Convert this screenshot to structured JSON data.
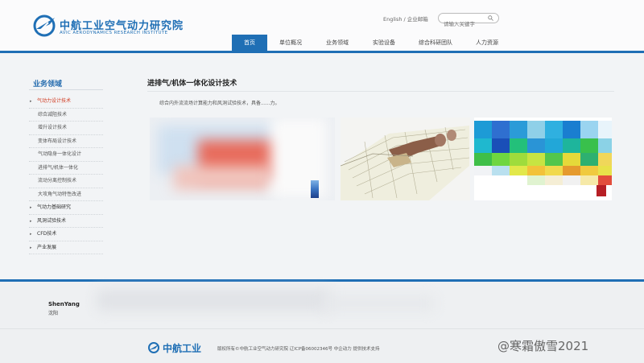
{
  "header": {
    "logo_cn": "中航工业空气动力研究院",
    "logo_en": "AVIC AERODYNAMICS RESEARCH INSTITUTE",
    "top_links": "English / 企业邮箱",
    "search_placeholder": "请输入关键字",
    "nav": [
      {
        "label": "首页",
        "active": true
      },
      {
        "label": "单位概况"
      },
      {
        "label": "业务领域"
      },
      {
        "label": "实验设备"
      },
      {
        "label": "综合科研团队"
      },
      {
        "label": "人力资源"
      }
    ]
  },
  "sidebar": {
    "title": "业务领域",
    "items": [
      {
        "label": "气动力设计技术",
        "type": "main",
        "current": true
      },
      {
        "label": "综合减阻技术",
        "type": "sub"
      },
      {
        "label": "增升设计技术",
        "type": "sub"
      },
      {
        "label": "变体布局设计技术",
        "type": "sub"
      },
      {
        "label": "气动隐身一体化设计",
        "type": "sub"
      },
      {
        "label": "进排气/机体一体化",
        "type": "sub"
      },
      {
        "label": "流动分离控制技术",
        "type": "sub"
      },
      {
        "label": "大攻角气动特性改进",
        "type": "sub"
      },
      {
        "label": "气动力基础研究",
        "type": "main"
      },
      {
        "label": "风洞试验技术",
        "type": "main"
      },
      {
        "label": "CFD技术",
        "type": "main"
      },
      {
        "label": "产业发展",
        "type": "main"
      }
    ]
  },
  "content": {
    "title": "进排气/机体一体化设计技术",
    "description": "综合内外流流场计算能力和风洞试验技术，具备......力。"
  },
  "footer": {
    "city_en": "ShenYang",
    "city_cn": "沈阳",
    "logo": "中航工业",
    "copyright": "版权所有©中航工业空气动力研究院   辽ICP备06002346号   中企动力 提供技术支持",
    "watermark": "@寒霜傲雪2021"
  },
  "colors": {
    "brand": "#1f6fb5",
    "active_side": "#d0391f"
  }
}
